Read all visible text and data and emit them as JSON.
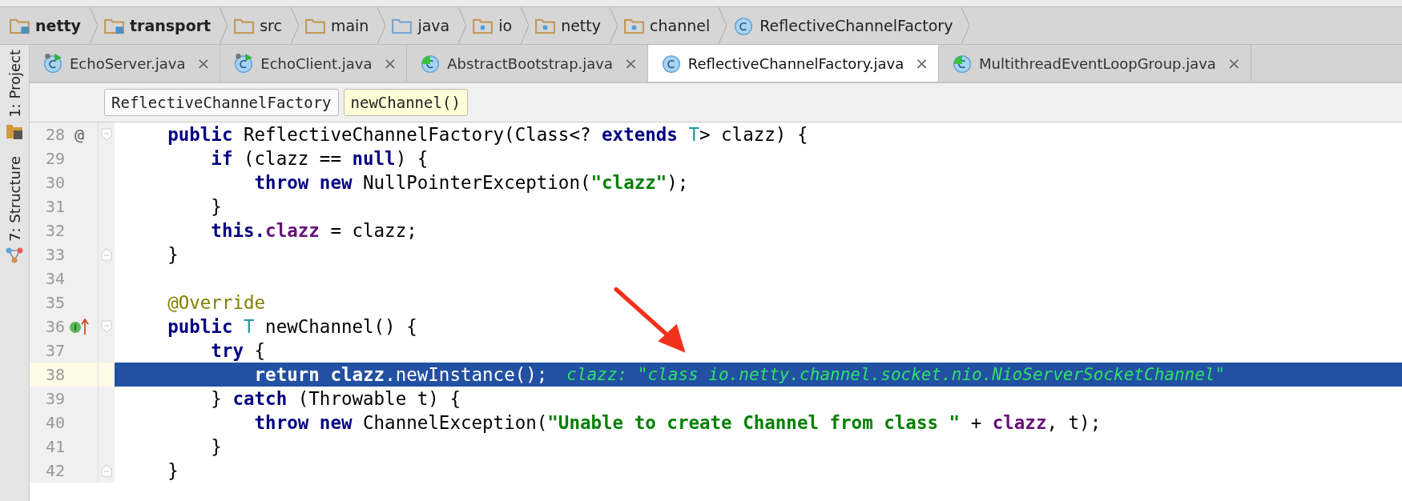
{
  "breadcrumbs": [
    {
      "label": "netty",
      "kind": "module"
    },
    {
      "label": "transport",
      "kind": "module"
    },
    {
      "label": "src",
      "kind": "folder"
    },
    {
      "label": "main",
      "kind": "folder"
    },
    {
      "label": "java",
      "kind": "source"
    },
    {
      "label": "io",
      "kind": "package"
    },
    {
      "label": "netty",
      "kind": "package"
    },
    {
      "label": "channel",
      "kind": "package"
    },
    {
      "label": "ReflectiveChannelFactory",
      "kind": "class"
    }
  ],
  "tool_windows": [
    {
      "label": "1: Project",
      "kind": "project"
    },
    {
      "label": "7: Structure",
      "kind": "structure"
    }
  ],
  "tabs": [
    {
      "label": "EchoServer.java",
      "kind": "runnable",
      "selected": false,
      "close": "×"
    },
    {
      "label": "EchoClient.java",
      "kind": "runnable",
      "selected": false,
      "close": "×"
    },
    {
      "label": "AbstractBootstrap.java",
      "kind": "partial",
      "selected": false,
      "close": "×"
    },
    {
      "label": "ReflectiveChannelFactory.java",
      "kind": "class",
      "selected": true,
      "close": "×"
    },
    {
      "label": "MultithreadEventLoopGroup.java",
      "kind": "partial",
      "selected": false,
      "close": "×"
    }
  ],
  "method_breadcrumbs": [
    {
      "label": "ReflectiveChannelFactory",
      "selected": false
    },
    {
      "label": "newChannel()",
      "selected": true
    }
  ],
  "editor": {
    "lines": [
      {
        "number": "28",
        "marker_text": "@",
        "fold": {
          "kind": "start"
        },
        "highlighted": false,
        "tokens": [
          {
            "kind": "kw",
            "text": "    public"
          },
          {
            "kind": "p",
            "text": " ReflectiveChannelFactory(Class<? "
          },
          {
            "kind": "kw",
            "text": "extends "
          },
          {
            "kind": "tp",
            "text": "T"
          },
          {
            "kind": "p",
            "text": "> clazz) {"
          }
        ]
      },
      {
        "number": "29",
        "highlighted": false,
        "tokens": [
          {
            "kind": "kw",
            "text": "        if"
          },
          {
            "kind": "p",
            "text": " (clazz == "
          },
          {
            "kind": "kw",
            "text": "null"
          },
          {
            "kind": "p",
            "text": ") {"
          }
        ]
      },
      {
        "number": "30",
        "highlighted": false,
        "tokens": [
          {
            "kind": "kw",
            "text": "            throw new"
          },
          {
            "kind": "p",
            "text": " NullPointerException("
          },
          {
            "kind": "str",
            "text": "\"clazz\""
          },
          {
            "kind": "p",
            "text": ");"
          }
        ]
      },
      {
        "number": "31",
        "highlighted": false,
        "tokens": [
          {
            "kind": "p",
            "text": "        }"
          }
        ]
      },
      {
        "number": "32",
        "highlighted": false,
        "tokens": [
          {
            "kind": "kw",
            "text": "        this."
          },
          {
            "kind": "f",
            "text": "clazz"
          },
          {
            "kind": "p",
            "text": " = clazz;"
          }
        ]
      },
      {
        "number": "33",
        "fold": {
          "kind": "end"
        },
        "highlighted": false,
        "tokens": [
          {
            "kind": "p",
            "text": "    }"
          }
        ]
      },
      {
        "number": "34",
        "highlighted": false
      },
      {
        "number": "35",
        "highlighted": false,
        "tokens": [
          {
            "kind": "an",
            "text": "    @Override"
          }
        ]
      },
      {
        "number": "36",
        "marker_icon": {
          "kind": "implements"
        },
        "fold": {
          "kind": "start"
        },
        "highlighted": false,
        "tokens": [
          {
            "kind": "kw",
            "text": "    public "
          },
          {
            "kind": "tp",
            "text": "T"
          },
          {
            "kind": "p",
            "text": " newChannel() {"
          }
        ]
      },
      {
        "number": "37",
        "highlighted": false,
        "tokens": [
          {
            "kind": "kw",
            "text": "        try"
          },
          {
            "kind": "p",
            "text": " {"
          }
        ]
      },
      {
        "number": "38",
        "highlighted": true,
        "tokens": [
          {
            "kind": "kw",
            "text": "            return "
          },
          {
            "kind": "f",
            "text": "clazz"
          },
          {
            "kind": "p",
            "text": ".newInstance();"
          }
        ],
        "inline_value": "clazz: \"class io.netty.channel.socket.nio.NioServerSocketChannel\""
      },
      {
        "number": "39",
        "highlighted": false,
        "tokens": [
          {
            "kind": "p",
            "text": "        } "
          },
          {
            "kind": "kw",
            "text": "catch"
          },
          {
            "kind": "p",
            "text": " (Throwable t) {"
          }
        ]
      },
      {
        "number": "40",
        "highlighted": false,
        "tokens": [
          {
            "kind": "kw",
            "text": "            throw new"
          },
          {
            "kind": "p",
            "text": " ChannelException("
          },
          {
            "kind": "str",
            "text": "\"Unable to create Channel from class \""
          },
          {
            "kind": "p",
            "text": " + "
          },
          {
            "kind": "f",
            "text": "clazz"
          },
          {
            "kind": "p",
            "text": ", t);"
          }
        ]
      },
      {
        "number": "41",
        "highlighted": false,
        "tokens": [
          {
            "kind": "p",
            "text": "        }"
          }
        ]
      },
      {
        "number": "42",
        "fold": {
          "kind": "end"
        },
        "highlighted": false,
        "tokens": [
          {
            "kind": "p",
            "text": "    }"
          }
        ]
      }
    ]
  }
}
